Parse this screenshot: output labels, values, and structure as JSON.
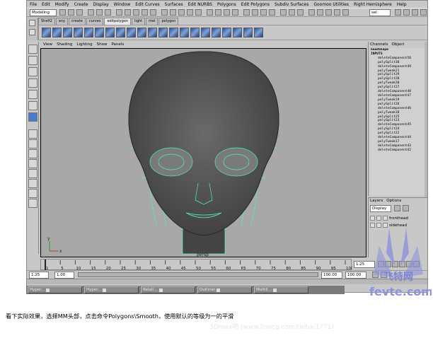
{
  "menubar": [
    "File",
    "Edit",
    "Modify",
    "Create",
    "Display",
    "Window",
    "Edit Curves",
    "Surfaces",
    "Edit NURBS",
    "Polygons",
    "Edit Polygons",
    "Subdiv Surfaces",
    "Goomoo Utilities",
    "Right Hemisphere",
    "Help"
  ],
  "status": {
    "mode": "Modeling",
    "sel_field": "sel"
  },
  "shelf_tabs": [
    {
      "label": "Shelf2",
      "active": false
    },
    {
      "label": "any",
      "active": false
    },
    {
      "label": "create",
      "active": false
    },
    {
      "label": "curves",
      "active": false
    },
    {
      "label": "editpolygon",
      "active": true
    },
    {
      "label": "light",
      "active": false
    },
    {
      "label": "mel",
      "active": false
    },
    {
      "label": "polygon",
      "active": false
    }
  ],
  "viewport": {
    "menu": [
      "View",
      "Shading",
      "Lighting",
      "Show",
      "Panels"
    ],
    "camera_label": "persp",
    "background": "#a8a8a8",
    "wire_color": "#4cf0c0",
    "axis_y": "y",
    "axis_x": "x"
  },
  "channel_box": {
    "tabs": [
      "Channels",
      "Object"
    ],
    "object": "headShape",
    "section": "INPUTS",
    "inputs": [
      "deleteComponent50",
      "polySplit30",
      "deleteComponent49",
      "polyTweak21",
      "polySplit29",
      "polySplit28",
      "polyTweak20",
      "polySplit27",
      "deleteComponent48",
      "deleteComponent47",
      "polyTweak19",
      "polySplit26",
      "deleteComponent46",
      "polyTweak18",
      "polySplit25",
      "polySplit23",
      "deleteComponent45",
      "polySplit24",
      "polySplit22",
      "deleteComponent44",
      "polyTweak17",
      "deleteComponent43",
      "deleteComponent42"
    ]
  },
  "layers": {
    "tabs": [
      "Layers",
      "Options"
    ],
    "display": "Display",
    "items": [
      "fronthead",
      "sidehead"
    ]
  },
  "timeline": {
    "ticks": [
      "1",
      "5",
      "10",
      "15",
      "20",
      "25",
      "30",
      "35",
      "40",
      "45",
      "50",
      "55",
      "60",
      "65",
      "70",
      "75",
      "80",
      "85",
      "90",
      "95",
      "100"
    ],
    "current": "1.25"
  },
  "range": {
    "start": "1.25",
    "start2": "1.00",
    "end": "100.00",
    "end2": "100.00"
  },
  "taskbar": [
    "Hyper...",
    "Hyper...",
    "Relati...",
    "Outliner",
    "Multili..."
  ],
  "caption": "看下实际效果，选择MM头部，点击命令Polygons\\Smooth，使用默认的等级为一的平滑",
  "watermark_url": "3Dmax吧 (www.linecg.com/tieba/1771)",
  "logo": {
    "text1": "飞特网",
    "text2": "fevte.com"
  }
}
